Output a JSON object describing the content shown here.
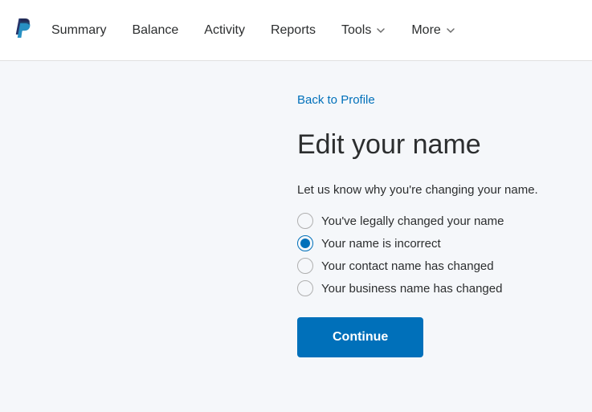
{
  "nav": {
    "items": [
      {
        "label": "Summary"
      },
      {
        "label": "Balance"
      },
      {
        "label": "Activity"
      },
      {
        "label": "Reports"
      },
      {
        "label": "Tools"
      },
      {
        "label": "More"
      }
    ]
  },
  "main": {
    "back_link": "Back to Profile",
    "title": "Edit your name",
    "subtitle": "Let us know why you're changing your name.",
    "options": [
      {
        "label": "You've legally changed your name",
        "selected": false
      },
      {
        "label": "Your name is incorrect",
        "selected": true
      },
      {
        "label": "Your contact name has changed",
        "selected": false
      },
      {
        "label": "Your business name has changed",
        "selected": false
      }
    ],
    "continue_label": "Continue"
  }
}
